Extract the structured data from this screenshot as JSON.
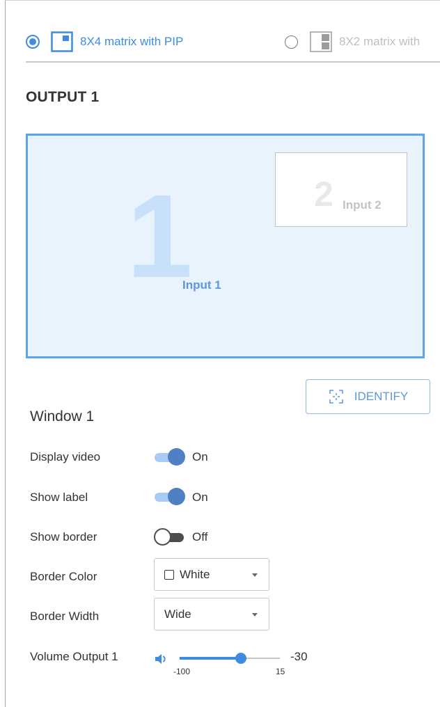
{
  "layouts": [
    {
      "label": "8X4 matrix with PIP",
      "selected": true,
      "icon": "pip-layout-icon"
    },
    {
      "label": "8X2 matrix with",
      "selected": false,
      "icon": "split-layout-icon"
    }
  ],
  "output": {
    "title": "OUTPUT 1"
  },
  "preview": {
    "window1": {
      "number": "1",
      "label": "Input 1"
    },
    "window2": {
      "number": "2",
      "label": "Input 2"
    }
  },
  "identify": {
    "label": "IDENTIFY",
    "icon": "identify-target-icon"
  },
  "window": {
    "title": "Window 1",
    "display_video": {
      "label": "Display video",
      "state": "On",
      "on": true
    },
    "show_label": {
      "label": "Show label",
      "state": "On",
      "on": true
    },
    "show_border": {
      "label": "Show border",
      "state": "Off",
      "on": false
    },
    "border_color": {
      "label": "Border Color",
      "value": "White"
    },
    "border_width": {
      "label": "Border Width",
      "value": "Wide"
    },
    "volume": {
      "label": "Volume Output 1",
      "min": "-100",
      "max": "15",
      "value": "-30",
      "level": -30
    }
  },
  "colors": {
    "accent": "#3d8ce0",
    "preview_bg": "#e9f3fd",
    "preview_border": "#5aa5ea",
    "toggle_on": "#4f7fc5"
  }
}
